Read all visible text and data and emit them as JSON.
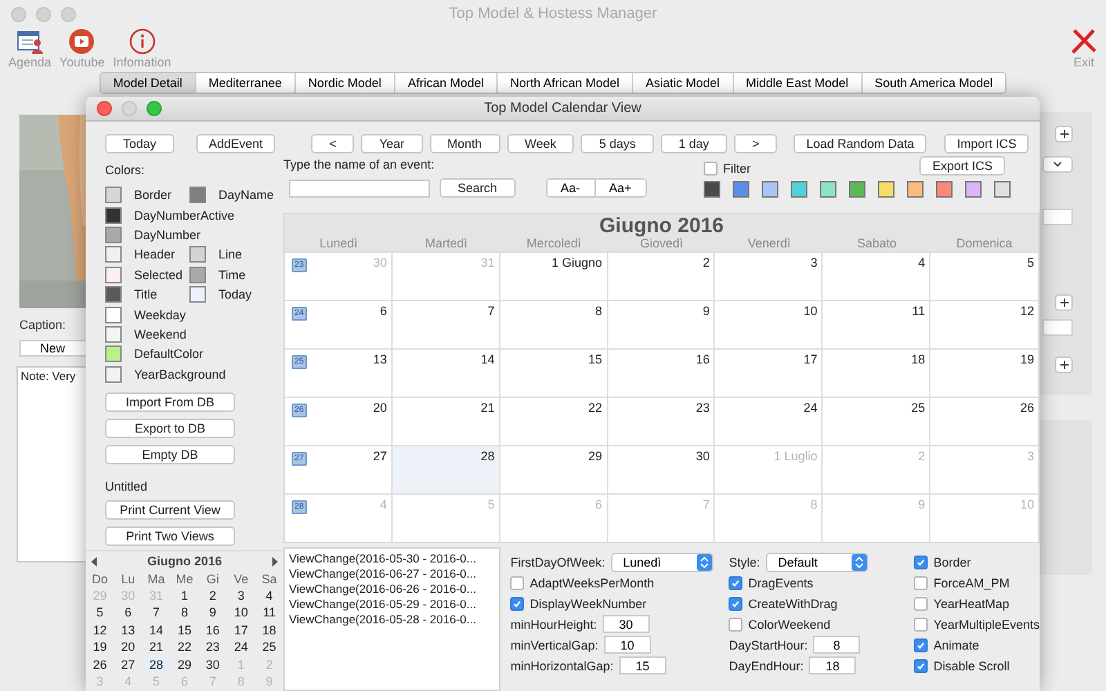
{
  "window": {
    "title": "Top Model & Hostess Manager"
  },
  "toolbar": [
    {
      "kind": "agenda",
      "label": "Agenda"
    },
    {
      "kind": "youtube",
      "label": "Youtube"
    },
    {
      "kind": "info",
      "label": "Infomation"
    }
  ],
  "exit": {
    "label": "Exit"
  },
  "tabs": [
    {
      "label": "Model Detail",
      "selected": true
    },
    {
      "label": "Mediterranee",
      "selected": false
    },
    {
      "label": "Nordic Model",
      "selected": false
    },
    {
      "label": "African Model",
      "selected": false
    },
    {
      "label": "North African Model",
      "selected": false
    },
    {
      "label": "Asiatic Model",
      "selected": false
    },
    {
      "label": "Middle East Model",
      "selected": false
    },
    {
      "label": "South America Model",
      "selected": false
    }
  ],
  "detail": {
    "caption_label": "Caption:",
    "new_button": "New",
    "note": "Note: Very"
  },
  "calendar_window": {
    "title": "Top Model Calendar View",
    "left_buttons": [
      "Today",
      "AddEvent"
    ],
    "view_buttons": [
      "<",
      "Year",
      "Month",
      "Week",
      "5 days",
      "1 day",
      ">"
    ],
    "load_button": "Load Random Data",
    "import_button": "Import ICS",
    "export_button": "Export ICS",
    "colors_label": "Colors:",
    "colors": [
      [
        {
          "name": "Border",
          "color": "#d6d6d6"
        },
        {
          "name": "DayName",
          "color": "#7f7f7f"
        }
      ],
      [
        {
          "name": "DayNumberActive",
          "color": "#333333"
        }
      ],
      [
        {
          "name": "DayNumber",
          "color": "#a9a9a9"
        }
      ],
      [
        {
          "name": "Header",
          "color": "#f0f0f0"
        },
        {
          "name": "Line",
          "color": "#d3d3d3"
        }
      ],
      [
        {
          "name": "Selected",
          "color": "#fdeef0"
        },
        {
          "name": "Time",
          "color": "#a9a9a9"
        }
      ],
      [
        {
          "name": "Title",
          "color": "#5a5a5a"
        },
        {
          "name": "Today",
          "color": "#eaf1fb"
        }
      ],
      [
        {
          "name": "Weekday",
          "color": "#ffffff"
        }
      ],
      [
        {
          "name": "Weekend",
          "color": "#f1f6f0"
        }
      ],
      [
        {
          "name": "DefaultColor",
          "color": "#b8f08a"
        }
      ],
      [
        {
          "name": "YearBackground",
          "color": "#f2f2f2"
        }
      ]
    ],
    "search_label": "Type the name of an event:",
    "search_button": "Search",
    "font_buttons": [
      "Aa-",
      "Aa+"
    ],
    "filter": {
      "label": "Filter",
      "checked": false
    },
    "palette": [
      {
        "color": "#4a4a4a"
      },
      {
        "color": "#5b8ee8"
      },
      {
        "color": "#a9c4f5"
      },
      {
        "color": "#4fd2d8"
      },
      {
        "color": "#8ee3c4"
      },
      {
        "color": "#5db957"
      },
      {
        "color": "#f8dc6a"
      },
      {
        "color": "#f8bd7e"
      },
      {
        "color": "#f78a7a"
      },
      {
        "color": "#dcb5f4"
      },
      {
        "color": "#e0e0e0"
      }
    ],
    "db_buttons": [
      "Import From DB",
      "Export to DB",
      "Empty DB"
    ],
    "document_name": "Untitled",
    "print_buttons": [
      "Print Current View",
      "Print Two Views"
    ],
    "mini_calendar": {
      "title": "Giugno 2016",
      "weekdays": [
        "Do",
        "Lu",
        "Ma",
        "Me",
        "Gi",
        "Ve",
        "Sa"
      ],
      "days": [
        {
          "label": "29",
          "muted": true,
          "today": false
        },
        {
          "label": "30",
          "muted": true,
          "today": false
        },
        {
          "label": "31",
          "muted": true,
          "today": false
        },
        {
          "label": "1",
          "muted": false,
          "today": false
        },
        {
          "label": "2",
          "muted": false,
          "today": false
        },
        {
          "label": "3",
          "muted": false,
          "today": false
        },
        {
          "label": "4",
          "muted": false,
          "today": false
        },
        {
          "label": "5",
          "muted": false,
          "today": false
        },
        {
          "label": "6",
          "muted": false,
          "today": false
        },
        {
          "label": "7",
          "muted": false,
          "today": false
        },
        {
          "label": "8",
          "muted": false,
          "today": false
        },
        {
          "label": "9",
          "muted": false,
          "today": false
        },
        {
          "label": "10",
          "muted": false,
          "today": false
        },
        {
          "label": "11",
          "muted": false,
          "today": false
        },
        {
          "label": "12",
          "muted": false,
          "today": false
        },
        {
          "label": "13",
          "muted": false,
          "today": false
        },
        {
          "label": "14",
          "muted": false,
          "today": false
        },
        {
          "label": "15",
          "muted": false,
          "today": false
        },
        {
          "label": "16",
          "muted": false,
          "today": false
        },
        {
          "label": "17",
          "muted": false,
          "today": false
        },
        {
          "label": "18",
          "muted": false,
          "today": false
        },
        {
          "label": "19",
          "muted": false,
          "today": false
        },
        {
          "label": "20",
          "muted": false,
          "today": false
        },
        {
          "label": "21",
          "muted": false,
          "today": false
        },
        {
          "label": "22",
          "muted": false,
          "today": false
        },
        {
          "label": "23",
          "muted": false,
          "today": false
        },
        {
          "label": "24",
          "muted": false,
          "today": false
        },
        {
          "label": "25",
          "muted": false,
          "today": false
        },
        {
          "label": "26",
          "muted": false,
          "today": false
        },
        {
          "label": "27",
          "muted": false,
          "today": false
        },
        {
          "label": "28",
          "muted": false,
          "today": true
        },
        {
          "label": "29",
          "muted": false,
          "today": false
        },
        {
          "label": "30",
          "muted": false,
          "today": false
        },
        {
          "label": "1",
          "muted": true,
          "today": false
        },
        {
          "label": "2",
          "muted": true,
          "today": false
        },
        {
          "label": "3",
          "muted": true,
          "today": false
        },
        {
          "label": "4",
          "muted": true,
          "today": false
        },
        {
          "label": "5",
          "muted": true,
          "today": false
        },
        {
          "label": "6",
          "muted": true,
          "today": false
        },
        {
          "label": "7",
          "muted": true,
          "today": false
        },
        {
          "label": "8",
          "muted": true,
          "today": false
        },
        {
          "label": "9",
          "muted": true,
          "today": false
        }
      ]
    },
    "calendar": {
      "title": "Giugno 2016",
      "weekdays": [
        "Lunedì",
        "Martedì",
        "Mercoledì",
        "Giovedì",
        "Venerdì",
        "Sabato",
        "Domenica"
      ],
      "weeks": [
        {
          "week": "23",
          "days": [
            {
              "label": "30",
              "muted": true,
              "today": false
            },
            {
              "label": "31",
              "muted": true,
              "today": false
            },
            {
              "label": "1 Giugno",
              "muted": false,
              "today": false
            },
            {
              "label": "2",
              "muted": false,
              "today": false
            },
            {
              "label": "3",
              "muted": false,
              "today": false
            },
            {
              "label": "4",
              "muted": false,
              "today": false
            },
            {
              "label": "5",
              "muted": false,
              "today": false
            }
          ]
        },
        {
          "week": "24",
          "days": [
            {
              "label": "6",
              "muted": false,
              "today": false
            },
            {
              "label": "7",
              "muted": false,
              "today": false
            },
            {
              "label": "8",
              "muted": false,
              "today": false
            },
            {
              "label": "9",
              "muted": false,
              "today": false
            },
            {
              "label": "10",
              "muted": false,
              "today": false
            },
            {
              "label": "11",
              "muted": false,
              "today": false
            },
            {
              "label": "12",
              "muted": false,
              "today": false
            }
          ]
        },
        {
          "week": "25",
          "days": [
            {
              "label": "13",
              "muted": false,
              "today": false
            },
            {
              "label": "14",
              "muted": false,
              "today": false
            },
            {
              "label": "15",
              "muted": false,
              "today": false
            },
            {
              "label": "16",
              "muted": false,
              "today": false
            },
            {
              "label": "17",
              "muted": false,
              "today": false
            },
            {
              "label": "18",
              "muted": false,
              "today": false
            },
            {
              "label": "19",
              "muted": false,
              "today": false
            }
          ]
        },
        {
          "week": "26",
          "days": [
            {
              "label": "20",
              "muted": false,
              "today": false
            },
            {
              "label": "21",
              "muted": false,
              "today": false
            },
            {
              "label": "22",
              "muted": false,
              "today": false
            },
            {
              "label": "23",
              "muted": false,
              "today": false
            },
            {
              "label": "24",
              "muted": false,
              "today": false
            },
            {
              "label": "25",
              "muted": false,
              "today": false
            },
            {
              "label": "26",
              "muted": false,
              "today": false
            }
          ]
        },
        {
          "week": "27",
          "days": [
            {
              "label": "27",
              "muted": false,
              "today": false
            },
            {
              "label": "28",
              "muted": false,
              "today": true
            },
            {
              "label": "29",
              "muted": false,
              "today": false
            },
            {
              "label": "30",
              "muted": false,
              "today": false
            },
            {
              "label": "1 Luglio",
              "muted": true,
              "today": false
            },
            {
              "label": "2",
              "muted": true,
              "today": false
            },
            {
              "label": "3",
              "muted": true,
              "today": false
            }
          ]
        },
        {
          "week": "28",
          "days": [
            {
              "label": "4",
              "muted": true,
              "today": false
            },
            {
              "label": "5",
              "muted": true,
              "today": false
            },
            {
              "label": "6",
              "muted": true,
              "today": false
            },
            {
              "label": "7",
              "muted": true,
              "today": false
            },
            {
              "label": "8",
              "muted": true,
              "today": false
            },
            {
              "label": "9",
              "muted": true,
              "today": false
            },
            {
              "label": "10",
              "muted": true,
              "today": false
            }
          ]
        }
      ]
    },
    "log": [
      "ViewChange(2016-05-30 - 2016-0...",
      "ViewChange(2016-06-27 - 2016-0...",
      "ViewChange(2016-06-26 - 2016-0...",
      "ViewChange(2016-05-29 - 2016-0...",
      "ViewChange(2016-05-28 - 2016-0..."
    ],
    "settings": [
      [
        {
          "kind": "select",
          "label": "FirstDayOfWeek:",
          "value": "Lunedì"
        },
        {
          "kind": "select",
          "label": "Style:",
          "value": "Default"
        },
        {
          "kind": "checkbox",
          "label": "Border",
          "checked": true
        }
      ],
      [
        {
          "kind": "checkbox",
          "label": "AdaptWeeksPerMonth",
          "checked": false
        },
        {
          "kind": "checkbox",
          "label": "DragEvents",
          "checked": true
        },
        {
          "kind": "checkbox",
          "label": "ForceAM_PM",
          "checked": false
        }
      ],
      [
        {
          "kind": "checkbox",
          "label": "DisplayWeekNumber",
          "checked": true
        },
        {
          "kind": "checkbox",
          "label": "CreateWithDrag",
          "checked": true
        },
        {
          "kind": "checkbox",
          "label": "YearHeatMap",
          "checked": false
        }
      ],
      [
        {
          "kind": "number",
          "label": "minHourHeight:",
          "value": "30"
        },
        {
          "kind": "checkbox",
          "label": "ColorWeekend",
          "checked": false
        },
        {
          "kind": "checkbox",
          "label": "YearMultipleEvents",
          "checked": false
        }
      ],
      [
        {
          "kind": "number",
          "label": "minVerticalGap:",
          "value": "10"
        },
        {
          "kind": "number",
          "label": "DayStartHour:",
          "value": "8"
        },
        {
          "kind": "checkbox",
          "label": "Animate",
          "checked": true
        }
      ],
      [
        {
          "kind": "number",
          "label": "minHorizontalGap:",
          "value": "15"
        },
        {
          "kind": "number",
          "label": "DayEndHour:",
          "value": "18"
        },
        {
          "kind": "checkbox",
          "label": "Disable Scroll",
          "checked": true
        }
      ]
    ]
  }
}
